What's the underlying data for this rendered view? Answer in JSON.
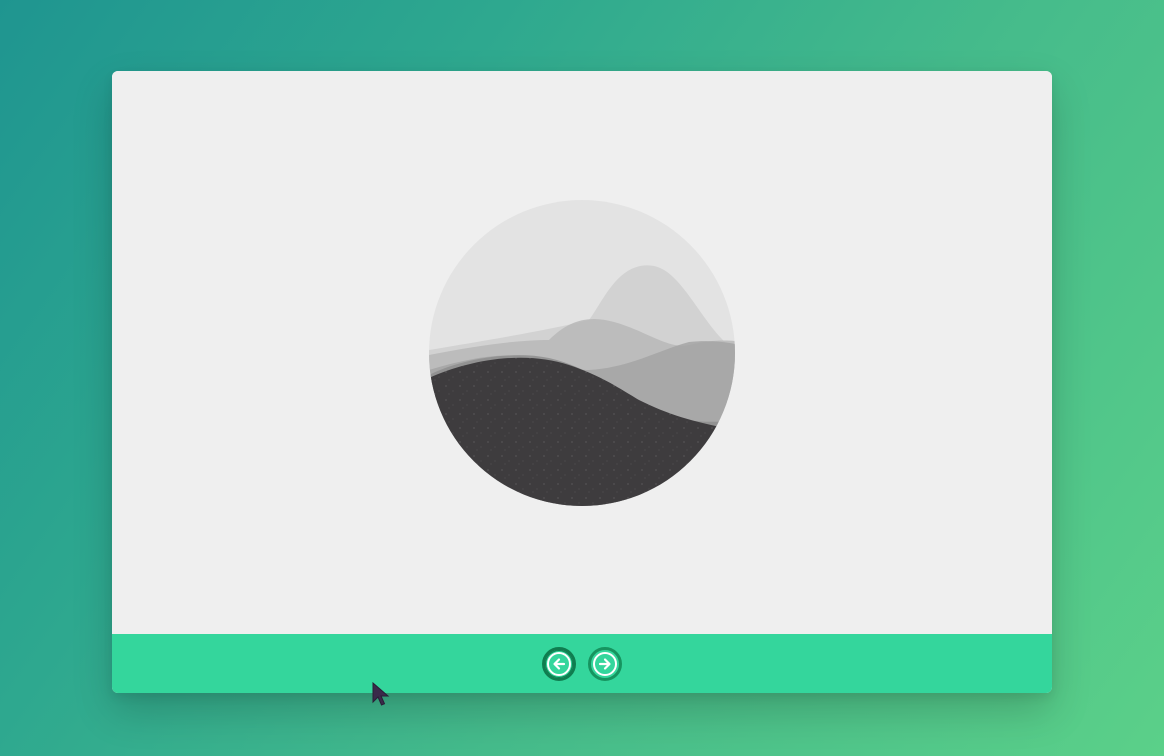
{
  "gallery": {
    "image": {
      "description_icon": "mountain-waves-artwork"
    },
    "controls": {
      "prev_icon": "arrow-left-circle-icon",
      "next_icon": "arrow-right-circle-icon"
    }
  },
  "colors": {
    "background_start": "#1f9590",
    "background_end": "#5bd089",
    "card_background": "#efefef",
    "control_bar": "#34d69c",
    "button_border": "#16945f",
    "icon": "#ffffff"
  }
}
